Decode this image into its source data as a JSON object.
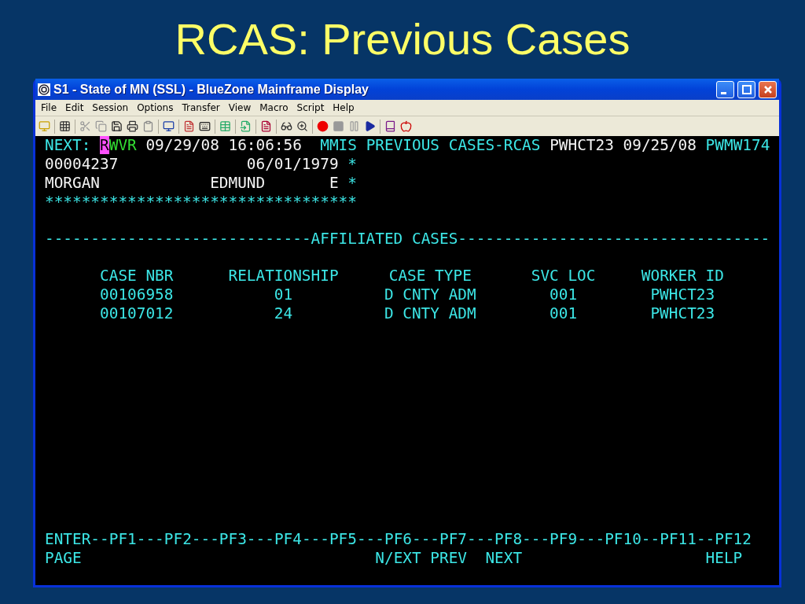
{
  "slide_title": "RCAS: Previous Cases",
  "window": {
    "title": "S1 - State of MN (SSL) - BlueZone Mainframe Display"
  },
  "menu": [
    "File",
    "Edit",
    "Session",
    "Options",
    "Transfer",
    "View",
    "Macro",
    "Script",
    "Help"
  ],
  "screen": {
    "header": {
      "next_label": "NEXT:",
      "command_cursor": "R",
      "command_rest": "WVR",
      "date": "09/29/08",
      "time": "16:06:56",
      "title": "MMIS PREVIOUS CASES-RCAS",
      "user": "PWHCT23",
      "user_date": "09/25/08",
      "terminal": "PWMW174"
    },
    "recipient": {
      "id": "00004237",
      "birth_date": "06/01/1979",
      "id_marker": "*",
      "last_name": "MORGAN",
      "first_name": "EDMUND",
      "middle_initial": "E",
      "name_marker": "*",
      "stars": "**********************************"
    },
    "section_divider": "-----------------------------AFFILIATED CASES----------------------------------",
    "table": {
      "columns": [
        "CASE NBR",
        "RELATIONSHIP",
        "CASE TYPE",
        "SVC LOC",
        "WORKER ID"
      ],
      "rows": [
        [
          "00106958",
          "01",
          "D CNTY ADM",
          "001",
          "PWHCT23"
        ],
        [
          "00107012",
          "24",
          "D CNTY ADM",
          "001",
          "PWHCT23"
        ]
      ]
    },
    "function_keys": [
      {
        "key": "ENTER--",
        "label": "PAGE"
      },
      {
        "key": "PF1---"
      },
      {
        "key": "PF2---"
      },
      {
        "key": "PF3---"
      },
      {
        "key": "PF4---"
      },
      {
        "key": "PF5---"
      },
      {
        "key": "PF6---",
        "label": "N/EXT"
      },
      {
        "key": "PF7---",
        "label": "PREV"
      },
      {
        "key": "PF8---",
        "label": "NEXT"
      },
      {
        "key": "PF9---"
      },
      {
        "key": "PF10--"
      },
      {
        "key": "PF11--"
      },
      {
        "key": "PF12",
        "label": "HELP"
      }
    ]
  }
}
